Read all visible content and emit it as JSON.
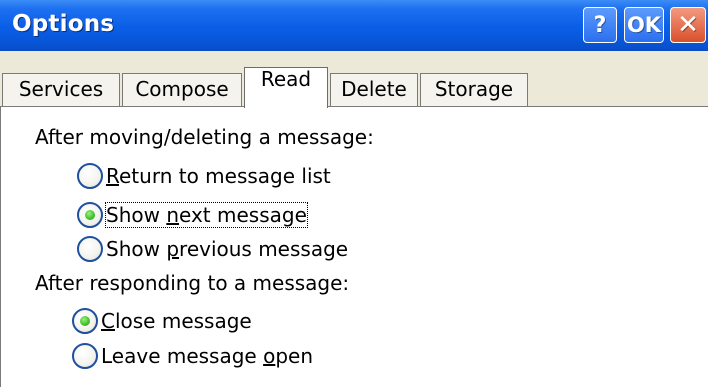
{
  "window": {
    "title": "Options",
    "help_label": "?",
    "ok_label": "OK",
    "close_label": "✕"
  },
  "tabs": [
    {
      "label": "Services",
      "active": false
    },
    {
      "label": "Compose",
      "active": false
    },
    {
      "label": "Read",
      "active": true
    },
    {
      "label": "Delete",
      "active": false
    },
    {
      "label": "Storage",
      "active": false
    }
  ],
  "read": {
    "group1_label": "After moving/deleting a message:",
    "group1_options": [
      {
        "prefix": "",
        "mnemonic": "R",
        "suffix": "eturn to message list",
        "checked": false
      },
      {
        "prefix": "Show ",
        "mnemonic": "n",
        "suffix": "ext message",
        "checked": true
      },
      {
        "prefix": "Show ",
        "mnemonic": "p",
        "suffix": "revious message",
        "checked": false
      }
    ],
    "group2_label": "After responding to a message:",
    "group2_options": [
      {
        "prefix": "",
        "mnemonic": "C",
        "suffix": "lose message",
        "checked": true
      },
      {
        "prefix": "Leave message ",
        "mnemonic": "o",
        "suffix": "pen",
        "checked": false
      }
    ]
  },
  "colors": {
    "title_bar": "#0a5ee6",
    "close_button": "#d9502c",
    "radio_checked": "#3fbf2c"
  }
}
